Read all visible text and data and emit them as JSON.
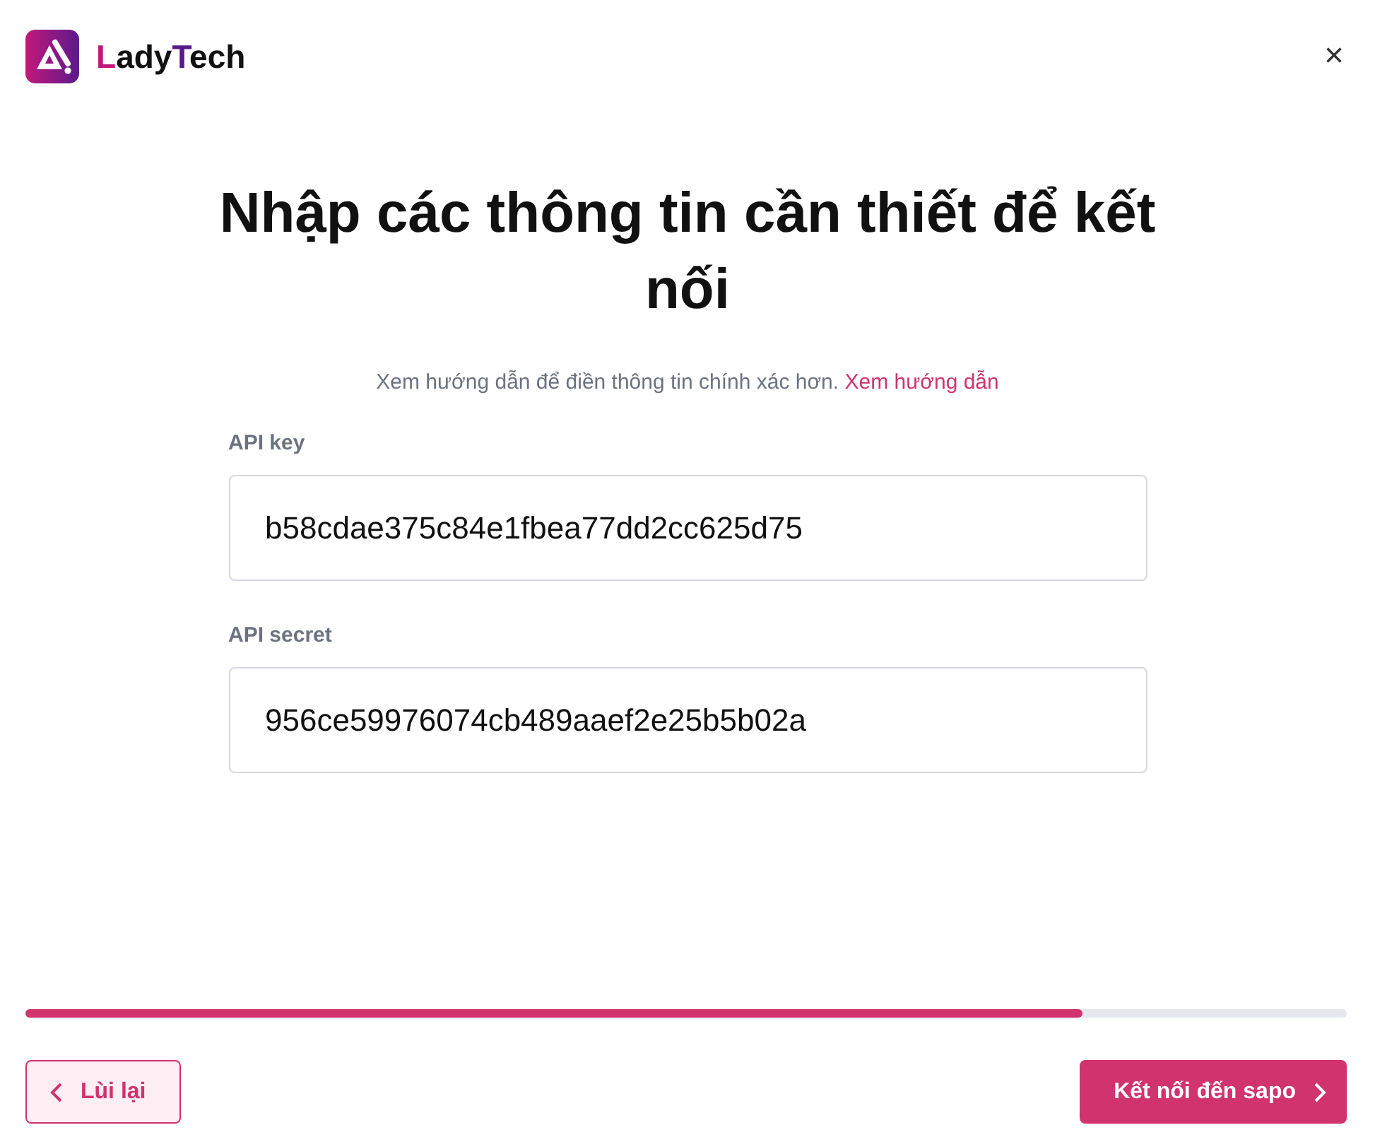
{
  "logo": {
    "segments": [
      {
        "text": "L",
        "color": "#c2187a"
      },
      {
        "text": "ady",
        "color": "#111111"
      },
      {
        "text": "T",
        "color": "#5b1a8c"
      },
      {
        "text": "ech",
        "color": "#111111"
      }
    ]
  },
  "close": "×",
  "title": "Nhập các thông tin cần thiết để kết nối",
  "hint": {
    "text": "Xem hướng dẫn để điền thông tin chính xác hơn.",
    "link": "Xem hướng dẫn"
  },
  "fields": [
    {
      "label": "API key",
      "value": "b58cdae375c84e1fbea77dd2cc625d75"
    },
    {
      "label": "API secret",
      "value": "956ce59976074cb489aaef2e25b5b02a"
    }
  ],
  "progress": {
    "level": 0.8
  },
  "back_button": "Lùi lại",
  "next_button": "Kết nối đến sapo"
}
